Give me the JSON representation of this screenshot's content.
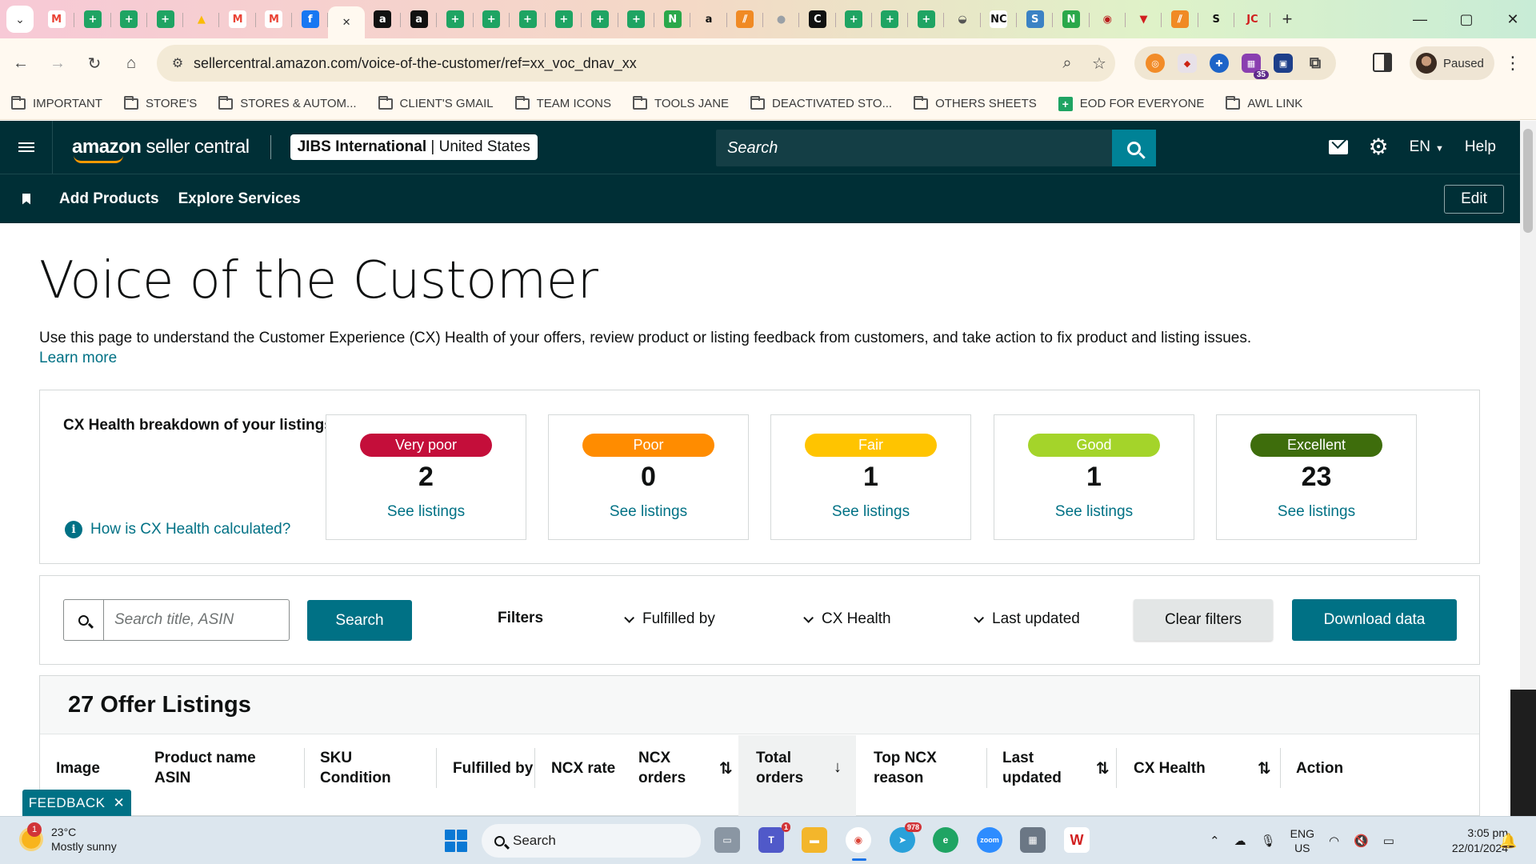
{
  "browser": {
    "tabs": [
      {
        "icon": "gmail-icon",
        "glyph": "M",
        "color": "#ea4335",
        "bg": "#ffffff"
      },
      {
        "icon": "sheets-icon",
        "glyph": "+",
        "color": "#ffffff",
        "bg": "#1fa463"
      },
      {
        "icon": "sheets-icon",
        "glyph": "+",
        "color": "#ffffff",
        "bg": "#1fa463"
      },
      {
        "icon": "sheets-icon",
        "glyph": "+",
        "color": "#ffffff",
        "bg": "#1fa463"
      },
      {
        "icon": "drive-icon",
        "glyph": "▲",
        "color": "#fbbc04",
        "bg": "transparent"
      },
      {
        "icon": "gmail-icon",
        "glyph": "M",
        "color": "#ea4335",
        "bg": "#ffffff"
      },
      {
        "icon": "gmail-icon",
        "glyph": "M",
        "color": "#ea4335",
        "bg": "#ffffff"
      },
      {
        "icon": "facebook-icon",
        "glyph": "f",
        "color": "#ffffff",
        "bg": "#1877f2"
      },
      {
        "icon": "close-icon",
        "glyph": "✕",
        "color": "#333333",
        "bg": "transparent",
        "active": true
      },
      {
        "icon": "amazon-icon",
        "glyph": "a",
        "color": "#ffffff",
        "bg": "#111111"
      },
      {
        "icon": "amazon-icon",
        "glyph": "a",
        "color": "#ffffff",
        "bg": "#111111"
      },
      {
        "icon": "sheets-icon",
        "glyph": "+",
        "color": "#ffffff",
        "bg": "#1fa463"
      },
      {
        "icon": "sheets-icon",
        "glyph": "+",
        "color": "#ffffff",
        "bg": "#1fa463"
      },
      {
        "icon": "sheets-icon",
        "glyph": "+",
        "color": "#ffffff",
        "bg": "#1fa463"
      },
      {
        "icon": "sheets-icon",
        "glyph": "+",
        "color": "#ffffff",
        "bg": "#1fa463"
      },
      {
        "icon": "sheets-icon",
        "glyph": "+",
        "color": "#ffffff",
        "bg": "#1fa463"
      },
      {
        "icon": "sheets-icon",
        "glyph": "+",
        "color": "#ffffff",
        "bg": "#1fa463"
      },
      {
        "icon": "n-logo-icon",
        "glyph": "N",
        "color": "#ffffff",
        "bg": "#2aa84a"
      },
      {
        "icon": "amazon-icon",
        "glyph": "a",
        "color": "#111111",
        "bg": "transparent"
      },
      {
        "icon": "stripes-icon",
        "glyph": "⫽",
        "color": "#ffffff",
        "bg": "#f08a24"
      },
      {
        "icon": "globe-icon",
        "glyph": "●",
        "color": "#9aa0a6",
        "bg": "transparent"
      },
      {
        "icon": "c-logo-icon",
        "glyph": "C",
        "color": "#ffffff",
        "bg": "#111111"
      },
      {
        "icon": "sheets-icon",
        "glyph": "+",
        "color": "#ffffff",
        "bg": "#1fa463"
      },
      {
        "icon": "sheets-icon",
        "glyph": "+",
        "color": "#ffffff",
        "bg": "#1fa463"
      },
      {
        "icon": "sheets-icon",
        "glyph": "+",
        "color": "#ffffff",
        "bg": "#1fa463"
      },
      {
        "icon": "car-icon",
        "glyph": "◒",
        "color": "#555555",
        "bg": "transparent"
      },
      {
        "icon": "nc-icon",
        "glyph": "NC",
        "color": "#111111",
        "bg": "#ffffff"
      },
      {
        "icon": "sysco-icon",
        "glyph": "S",
        "color": "#ffffff",
        "bg": "#3b82c4"
      },
      {
        "icon": "n-logo-icon",
        "glyph": "N",
        "color": "#ffffff",
        "bg": "#2aa84a"
      },
      {
        "icon": "badge-icon",
        "glyph": "◉",
        "color": "#b91c1c",
        "bg": "transparent"
      },
      {
        "icon": "shield-icon",
        "glyph": "▼",
        "color": "#d11f1f",
        "bg": "transparent"
      },
      {
        "icon": "stripes-icon",
        "glyph": "⫽",
        "color": "#ffffff",
        "bg": "#f08a24"
      },
      {
        "icon": "stan-icon",
        "glyph": "S",
        "color": "#111111",
        "bg": "transparent"
      },
      {
        "icon": "jc-icon",
        "glyph": "JC",
        "color": "#d11f1f",
        "bg": "transparent"
      }
    ],
    "window_controls": [
      "—",
      "▢",
      "✕"
    ],
    "url": "sellercentral.amazon.com/voice-of-the-customer/ref=xx_voc_dnav_xx",
    "profile_label": "Paused",
    "ext_badge": "35",
    "bookmarks": [
      {
        "label": "IMPORTANT",
        "icon": "folder-icon"
      },
      {
        "label": "STORE'S",
        "icon": "folder-icon"
      },
      {
        "label": "STORES & AUTOM...",
        "icon": "folder-icon"
      },
      {
        "label": "CLIENT'S GMAIL",
        "icon": "folder-icon"
      },
      {
        "label": "TEAM ICONS",
        "icon": "folder-icon"
      },
      {
        "label": "TOOLS JANE",
        "icon": "folder-icon"
      },
      {
        "label": "DEACTIVATED STO...",
        "icon": "folder-icon"
      },
      {
        "label": "OTHERS SHEETS",
        "icon": "folder-icon"
      },
      {
        "label": "EOD FOR EVERYONE",
        "icon": "sheets-icon"
      },
      {
        "label": "AWL LINK",
        "icon": "folder-icon"
      }
    ]
  },
  "header": {
    "logo_bold": "amazon",
    "logo_thin": " seller central",
    "account_name": "JIBS International",
    "account_region": "United States",
    "search_placeholder": "Search",
    "language": "EN",
    "help": "Help"
  },
  "nav": {
    "links": [
      "Add Products",
      "Explore Services"
    ],
    "edit": "Edit"
  },
  "page": {
    "title": "Voice of the Customer",
    "intro": "Use this page to understand the Customer Experience (CX) Health of your offers, review product or listing feedback from customers, and take action to fix product and listing issues.",
    "learn_more": "Learn more"
  },
  "health": {
    "title": "CX Health breakdown of your listings",
    "how_link": "How is CX Health calculated?",
    "cards": [
      {
        "label": "Very poor",
        "count": "2",
        "link": "See listings",
        "color": "#c40e3a"
      },
      {
        "label": "Poor",
        "count": "0",
        "link": "See listings",
        "color": "#ff8c00"
      },
      {
        "label": "Fair",
        "count": "1",
        "link": "See listings",
        "color": "#ffc400"
      },
      {
        "label": "Good",
        "count": "1",
        "link": "See listings",
        "color": "#a4d42a"
      },
      {
        "label": "Excellent",
        "count": "23",
        "link": "See listings",
        "color": "#3e6d0c"
      }
    ]
  },
  "filters": {
    "search_placeholder": "Search title, ASIN",
    "search_button": "Search",
    "label": "Filters",
    "dropdowns": [
      "Fulfilled by",
      "CX Health",
      "Last updated"
    ],
    "clear": "Clear filters",
    "download": "Download data"
  },
  "listings": {
    "title": "27 Offer Listings",
    "columns": [
      {
        "l1": "Image",
        "l2": ""
      },
      {
        "l1": "Product name",
        "l2": "ASIN"
      },
      {
        "l1": "SKU",
        "l2": "Condition"
      },
      {
        "l1": "Fulfilled by",
        "l2": ""
      },
      {
        "l1": "NCX rate",
        "l2": ""
      },
      {
        "l1": "NCX",
        "l2": "orders"
      },
      {
        "l1": "Total",
        "l2": "orders"
      },
      {
        "l1": "Top NCX",
        "l2": "reason"
      },
      {
        "l1": "Last",
        "l2": "updated"
      },
      {
        "l1": "CX Health",
        "l2": ""
      },
      {
        "l1": "Action",
        "l2": ""
      }
    ]
  },
  "feedback": "FEEDBACK",
  "taskbar": {
    "weather_temp": "23°C",
    "weather_desc": "Mostly sunny",
    "weather_badge": "1",
    "search": "Search",
    "lang_1": "ENG",
    "lang_2": "US",
    "time": "3:05 pm",
    "date": "22/01/2024",
    "badges": {
      "teams": "1",
      "telegram": "978"
    }
  }
}
